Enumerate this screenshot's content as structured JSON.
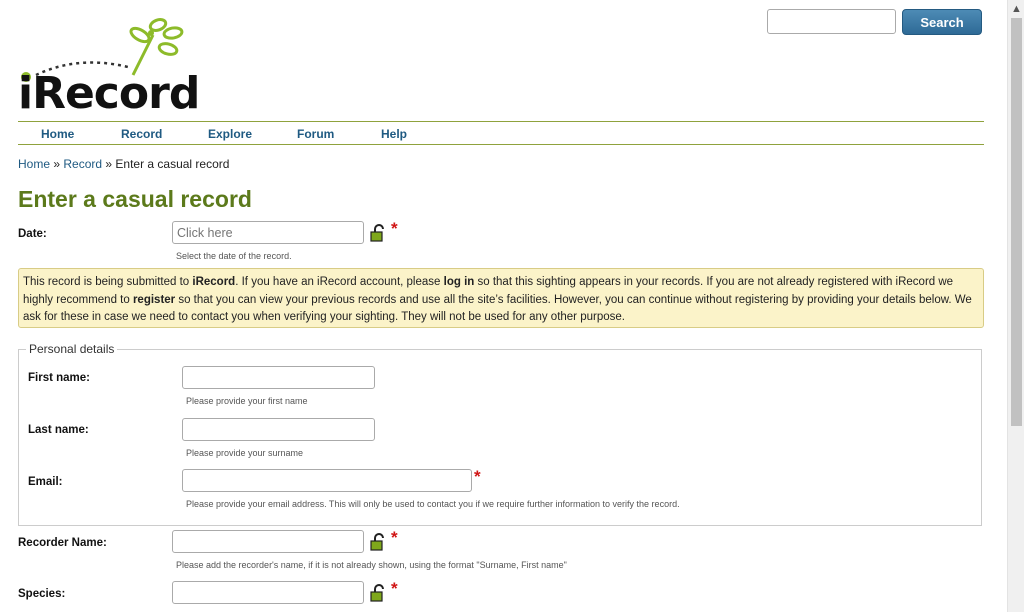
{
  "search": {
    "placeholder": "",
    "button_label": "Search"
  },
  "logo": {
    "text": "iRecord"
  },
  "nav": {
    "items": [
      "Home",
      "Record",
      "Explore",
      "Forum",
      "Help"
    ]
  },
  "breadcrumb": {
    "home": "Home",
    "sep1": " » ",
    "record": "Record",
    "sep2": " » ",
    "current": "Enter a casual record"
  },
  "page": {
    "title": "Enter a casual record"
  },
  "date": {
    "label": "Date:",
    "placeholder": "Click here",
    "help": "Select the date of the record."
  },
  "notice": {
    "t1": "This record is being submitted to ",
    "b1": "iRecord",
    "t2": ". If you have an iRecord account, please ",
    "b2": "log in",
    "t3": " so that this sighting appears in your records. If you are not already registered with iRecord we highly recommend to ",
    "b3": "register",
    "t4": " so that you can view your previous records and use all the site’s facilities. However, you can continue without registering by providing your details below. We ask for these in case we need to contact you when verifying your sighting. They will not be used for any other purpose."
  },
  "personal": {
    "legend": "Personal details",
    "first_name": {
      "label": "First name:",
      "help": "Please provide your first name"
    },
    "last_name": {
      "label": "Last name:",
      "help": "Please provide your surname"
    },
    "email": {
      "label": "Email:",
      "help": "Please provide your email address. This will only be used to contact you if we require further information to verify the record."
    }
  },
  "recorder": {
    "label": "Recorder Name:",
    "help": "Please add the recorder's name, if it is not already shown, using the format \"Surname, First name\""
  },
  "species": {
    "label": "Species:"
  },
  "required_marker": "*",
  "colors": {
    "title": "#5c7a1b",
    "nav_link": "#1f5a82",
    "required": "#d01515",
    "notice_bg": "#fbf3c9",
    "search_button": "#2e6a96"
  }
}
